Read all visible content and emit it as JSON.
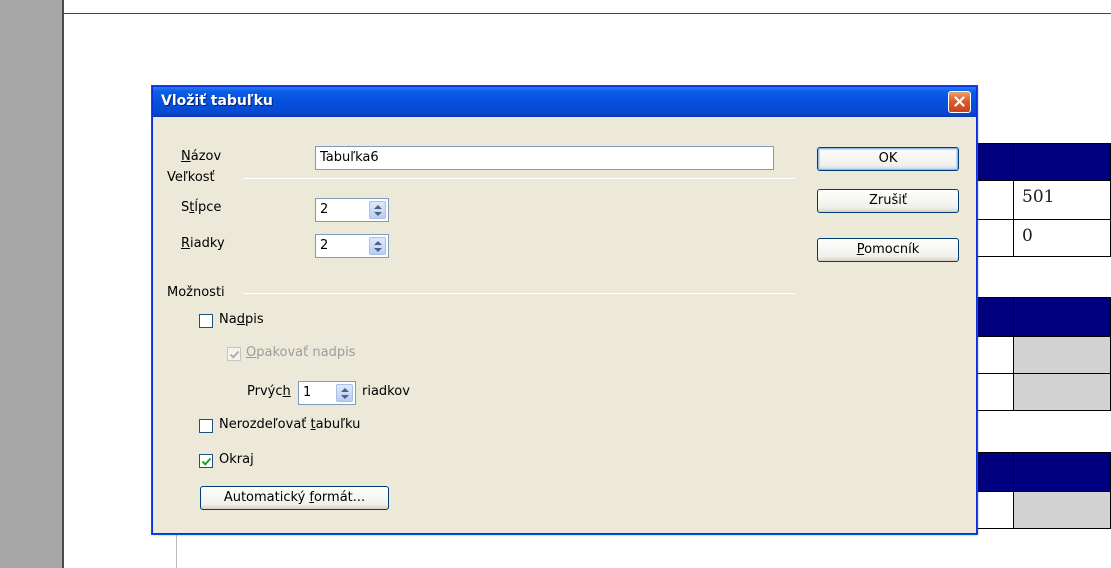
{
  "document": {
    "table_values": [
      "501",
      "0"
    ]
  },
  "dialog": {
    "title": "Vložiť tabuľku",
    "name_label": {
      "underlined": "N",
      "rest": "ázov"
    },
    "name_value": "Tabuľka6",
    "size_section": "Veľkosť",
    "columns_label": {
      "before": "S",
      "underlined": "t",
      "after": "ĺpce"
    },
    "columns_value": "2",
    "rows_label": {
      "underlined": "R",
      "rest": "iadky"
    },
    "rows_value": "2",
    "options_section": "Možnosti",
    "heading_checkbox": {
      "before": "Na",
      "underlined": "d",
      "after": "pis",
      "checked": false
    },
    "repeat_heading_checkbox": {
      "underlined": "O",
      "rest": "pakovať nadpis",
      "checked": true,
      "disabled": true
    },
    "first_label": {
      "before": "Prvýc",
      "underlined": "h"
    },
    "first_value": "1",
    "rows_suffix": "riadkov",
    "dont_split_checkbox": {
      "before": "Nerozdeľovať ",
      "underlined": "t",
      "after": "abuľku",
      "checked": false
    },
    "border_checkbox": {
      "before": "Okra",
      "underlined": "j",
      "checked": true
    },
    "autoformat_button": {
      "before": "Automatický ",
      "underlined": "f",
      "after": "ormát..."
    },
    "ok_button": "OK",
    "cancel_button": "Zrušiť",
    "help_button": {
      "underlined": "P",
      "rest": "omocník"
    }
  }
}
